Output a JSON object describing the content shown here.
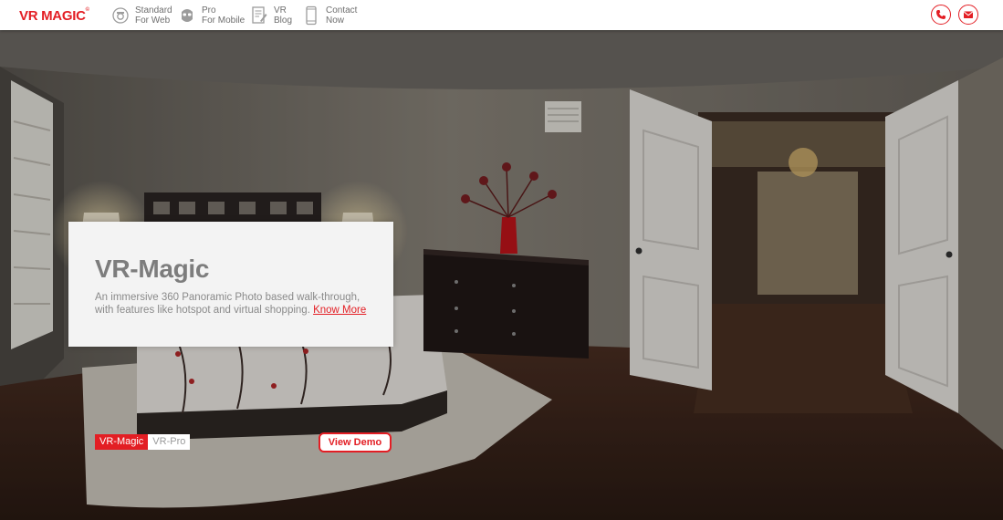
{
  "header": {
    "logo": "VR MAGIC",
    "logo_mark": "©",
    "nav": [
      {
        "line1": "Standard",
        "line2": "For Web",
        "icon": "camera-360-icon"
      },
      {
        "line1": "Pro",
        "line2": "For Mobile",
        "icon": "vr-headset-icon"
      },
      {
        "line1": "VR",
        "line2": "Blog",
        "icon": "blog-edit-icon"
      },
      {
        "line1": "Contact",
        "line2": "Now",
        "icon": "mobile-phone-icon"
      }
    ],
    "actions": [
      {
        "icon": "phone-icon"
      },
      {
        "icon": "mail-icon"
      }
    ]
  },
  "hero": {
    "card": {
      "title": "VR-Magic",
      "description": "An immersive 360 Panoramic Photo based walk-through, with features like hotspot and virtual shopping.",
      "link": "Know More"
    },
    "tabs": [
      "VR-Magic",
      "VR-Pro"
    ],
    "active_tab": "VR-Magic",
    "demo_button": "View Demo"
  },
  "colors": {
    "accent": "#e31e24",
    "card_bg": "#f3f3f3",
    "title_gray": "#7d7d7d"
  }
}
